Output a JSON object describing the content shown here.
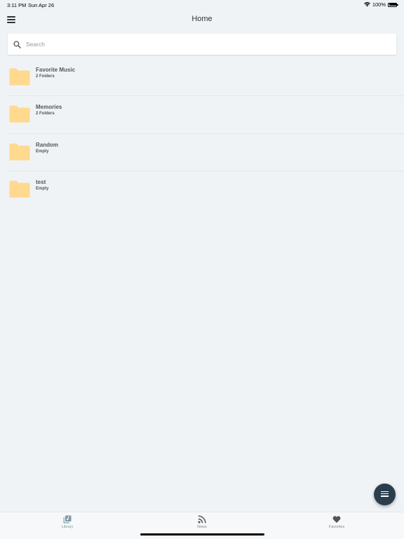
{
  "status_bar": {
    "time": "3:11 PM",
    "date": "Sun Apr 26",
    "battery": "100%"
  },
  "nav": {
    "title": "Home",
    "menu_icon": "hamburger-menu-icon"
  },
  "search": {
    "placeholder": "Search",
    "value": ""
  },
  "folders": [
    {
      "name": "Favorite Music",
      "subtitle": "2 Folders"
    },
    {
      "name": "Memories",
      "subtitle": "2 Folders"
    },
    {
      "name": "Random",
      "subtitle": "Empty"
    },
    {
      "name": "test",
      "subtitle": "Empty"
    }
  ],
  "fab": {
    "icon": "list-menu-icon"
  },
  "tabs": [
    {
      "label": "Library",
      "icon": "library-icon",
      "active": true
    },
    {
      "label": "News",
      "icon": "rss-feed-icon",
      "active": false
    },
    {
      "label": "Favorites",
      "icon": "heart-icon",
      "active": false
    }
  ],
  "colors": {
    "background": "#eff3f6",
    "folder": "#ffd98e",
    "fab": "#2c3e4c",
    "active_tab": "#7c9aa5"
  }
}
